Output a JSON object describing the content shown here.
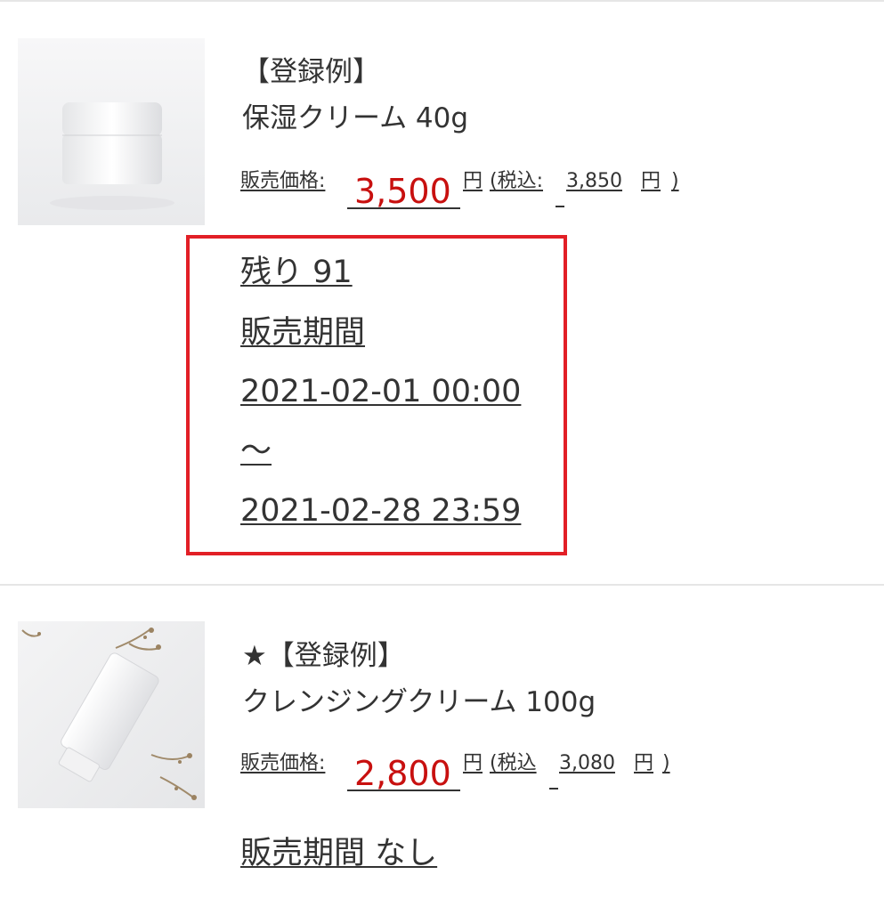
{
  "products": [
    {
      "image_desc": "white-cream-jar-photo",
      "label": "【登録例】",
      "name": "保湿クリーム 40g",
      "price_label": "販売価格:",
      "price": "3,500",
      "yen": "円",
      "tax_open": "(税込:",
      "tax_price": "3,850",
      "tax_yen": "円",
      "tax_close": ")",
      "stock": "残り 91",
      "period_label": "販売期間",
      "period_start": "2021-02-01 00:00",
      "period_sep": "〜",
      "period_end": "2021-02-28 23:59"
    },
    {
      "image_desc": "cleansing-cream-tube-photo",
      "label": "★【登録例】",
      "name": "クレンジングクリーム 100g",
      "price_label": "販売価格:",
      "price": "2,800",
      "yen": "円",
      "tax_open": "(税込",
      "tax_price": "3,080",
      "tax_yen": "円",
      "tax_close": ")",
      "period": "販売期間 なし"
    }
  ],
  "colors": {
    "price_red": "#c8100f",
    "highlight_border": "#e21f26",
    "divider": "#e6e6e6"
  }
}
